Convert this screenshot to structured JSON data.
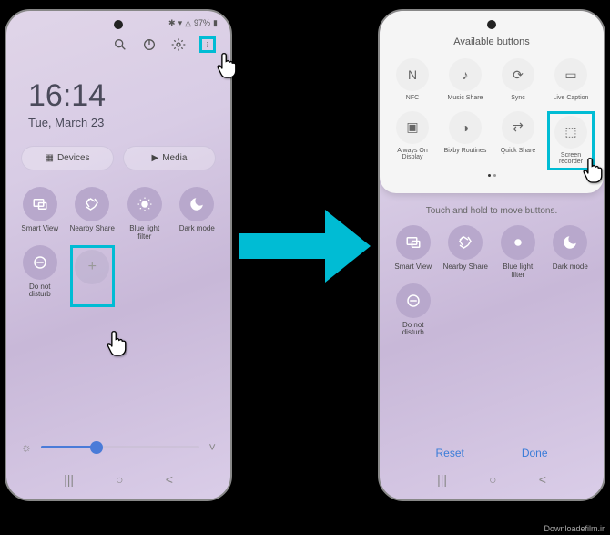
{
  "left": {
    "status": {
      "battery": "97%"
    },
    "clock": {
      "time": "16:14",
      "date": "Tue, March 23"
    },
    "buttons": {
      "devices": "Devices",
      "media": "Media"
    },
    "tiles": [
      {
        "label": "Smart View"
      },
      {
        "label": "Nearby Share"
      },
      {
        "label": "Blue light filter"
      },
      {
        "label": "Dark mode"
      },
      {
        "label": "Do not disturb"
      },
      {
        "label": ""
      },
      {
        "label": ""
      },
      {
        "label": ""
      }
    ]
  },
  "right": {
    "panel_title": "Available buttons",
    "panel_tiles": [
      {
        "label": "NFC"
      },
      {
        "label": "Music Share"
      },
      {
        "label": "Sync"
      },
      {
        "label": "Live Caption"
      },
      {
        "label": "Always On Display"
      },
      {
        "label": "Bixby Routines"
      },
      {
        "label": "Quick Share"
      },
      {
        "label": "Screen recorder"
      }
    ],
    "hint": "Touch and hold to move buttons.",
    "tiles": [
      {
        "label": "Smart View"
      },
      {
        "label": "Nearby Share"
      },
      {
        "label": "Blue light filter"
      },
      {
        "label": "Dark mode"
      },
      {
        "label": "Do not disturb"
      }
    ],
    "reset": "Reset",
    "done": "Done"
  },
  "watermark": "Downloadefilm.ir"
}
